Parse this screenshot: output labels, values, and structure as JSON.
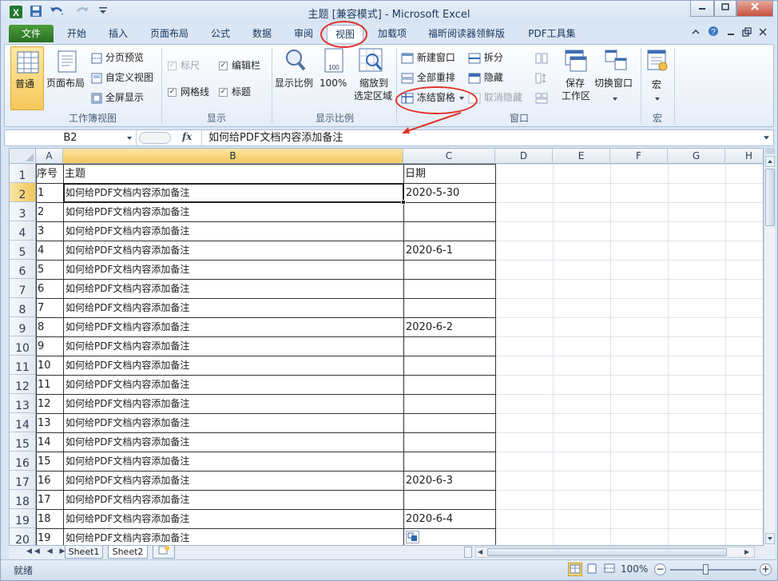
{
  "window": {
    "title": "主题 [兼容模式] - Microsoft Excel"
  },
  "tabs": [
    "文件",
    "开始",
    "插入",
    "页面布局",
    "公式",
    "数据",
    "审阅",
    "视图",
    "加载项",
    "福昕阅读器领鲜版",
    "PDF工具集"
  ],
  "ribbon": {
    "workbook_views": {
      "label": "工作簿视图",
      "normal": "普通",
      "page_layout": "页面布局",
      "page_break_preview": "分页预览",
      "custom_views": "自定义视图",
      "full_screen": "全屏显示"
    },
    "show": {
      "label": "显示",
      "ruler": "标尺",
      "formula_bar": "编辑栏",
      "gridlines": "网格线",
      "headings": "标题"
    },
    "zoom": {
      "label": "显示比例",
      "zoom": "显示比例",
      "zoom_100": "100%",
      "zoom_selection_line1": "缩放到",
      "zoom_selection_line2": "选定区域"
    },
    "window": {
      "label": "窗口",
      "new_window": "新建窗口",
      "arrange_all": "全部重排",
      "freeze_panes": "冻结窗格",
      "split": "拆分",
      "hide": "隐藏",
      "unhide": "取消隐藏",
      "save_workspace_line1": "保存",
      "save_workspace_line2": "工作区",
      "switch_windows": "切换窗口"
    },
    "macros": {
      "label": "宏",
      "macros": "宏"
    }
  },
  "formula_bar": {
    "name_box": "B2",
    "fx": "fx",
    "content": "如何给PDF文档内容添加备注"
  },
  "grid": {
    "columns": [
      "A",
      "B",
      "C",
      "D",
      "E",
      "F",
      "G",
      "H"
    ],
    "header_row": {
      "a": "序号",
      "b": "主题",
      "c": "日期"
    },
    "rows": [
      {
        "num": "2",
        "a": "1",
        "b": "如何给PDF文档内容添加备注",
        "c": "2020-5-30"
      },
      {
        "num": "3",
        "a": "2",
        "b": "如何给PDF文档内容添加备注",
        "c": ""
      },
      {
        "num": "4",
        "a": "3",
        "b": "如何给PDF文档内容添加备注",
        "c": ""
      },
      {
        "num": "5",
        "a": "4",
        "b": "如何给PDF文档内容添加备注",
        "c": "2020-6-1"
      },
      {
        "num": "6",
        "a": "5",
        "b": "如何给PDF文档内容添加备注",
        "c": ""
      },
      {
        "num": "7",
        "a": "6",
        "b": "如何给PDF文档内容添加备注",
        "c": ""
      },
      {
        "num": "8",
        "a": "7",
        "b": "如何给PDF文档内容添加备注",
        "c": ""
      },
      {
        "num": "9",
        "a": "8",
        "b": "如何给PDF文档内容添加备注",
        "c": "2020-6-2"
      },
      {
        "num": "10",
        "a": "9",
        "b": "如何给PDF文档内容添加备注",
        "c": ""
      },
      {
        "num": "11",
        "a": "10",
        "b": "如何给PDF文档内容添加备注",
        "c": ""
      },
      {
        "num": "12",
        "a": "11",
        "b": "如何给PDF文档内容添加备注",
        "c": ""
      },
      {
        "num": "13",
        "a": "12",
        "b": "如何给PDF文档内容添加备注",
        "c": ""
      },
      {
        "num": "14",
        "a": "13",
        "b": "如何给PDF文档内容添加备注",
        "c": ""
      },
      {
        "num": "15",
        "a": "14",
        "b": "如何给PDF文档内容添加备注",
        "c": ""
      },
      {
        "num": "16",
        "a": "15",
        "b": "如何给PDF文档内容添加备注",
        "c": ""
      },
      {
        "num": "17",
        "a": "16",
        "b": "如何给PDF文档内容添加备注",
        "c": "2020-6-3"
      },
      {
        "num": "18",
        "a": "17",
        "b": "如何给PDF文档内容添加备注",
        "c": ""
      },
      {
        "num": "19",
        "a": "18",
        "b": "如何给PDF文档内容添加备注",
        "c": "2020-6-4"
      },
      {
        "num": "20",
        "a": "19",
        "b": "如何给PDF文档内容添加备注",
        "c": ""
      }
    ]
  },
  "sheets": [
    "Sheet1",
    "Sheet2"
  ],
  "status": {
    "ready": "就绪",
    "zoom": "100%"
  },
  "colors": {
    "annotation": "#e0322b",
    "selected_header": "#f7d77c",
    "file_tab": "#2f7a28"
  }
}
